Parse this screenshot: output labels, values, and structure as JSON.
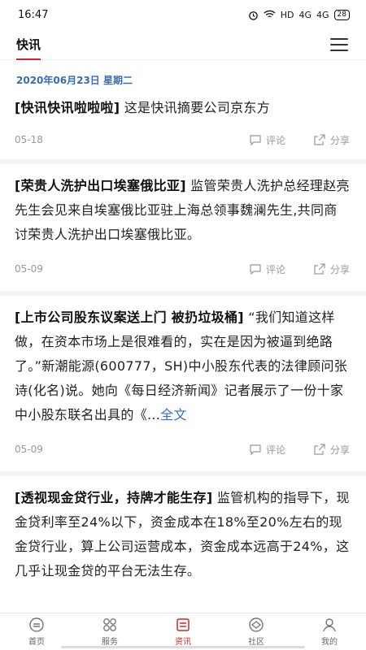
{
  "status_bar": {
    "time": "16:47",
    "network": "HD",
    "signal1": "4G",
    "signal2": "4G",
    "battery": "28"
  },
  "topbar": {
    "title": "快讯"
  },
  "date_line": "2020年06月23日  星期二",
  "feed": {
    "comment_label": "评论",
    "share_label": "分享",
    "items": [
      {
        "headline": "[快讯快讯啦啦啦]",
        "body": " 这是快讯摘要公司京东方",
        "more": "",
        "date": "05-18"
      },
      {
        "headline": "[荣贵人洗护出口埃塞俄比亚]",
        "body": " 监管荣贵人洗护总经理赵亮先生会见来自埃塞俄比亚驻上海总领事魏澜先生,共同商讨荣贵人洗护出口埃塞俄比亚。",
        "more": "",
        "date": "05-09"
      },
      {
        "headline": "[上市公司股东议案送上门 被扔垃圾桶]",
        "body": " “我们知道这样做，在资本市场上是很难看的，实在是因为被逼到绝路了。”新潮能源(600777，SH)中小股东代表的法律顾问张诗(化名)说。她向《每日经济新闻》记者展示了一份十家中小股东联名出具的《...",
        "more": "全文",
        "date": "05-09"
      },
      {
        "headline": "[透视现金贷行业，持牌才能生存]",
        "body": " 监管机构的指导下，现金贷利率至24%以下，资金成本在18%至20%左右的现金贷行业，算上公司运营成本，资金成本远高于24%，这几乎让现金贷的平台无法生存。",
        "more": "",
        "date": ""
      }
    ]
  },
  "bottom_nav": [
    {
      "label": "首页",
      "icon": "home-icon"
    },
    {
      "label": "服务",
      "icon": "grid-icon"
    },
    {
      "label": "资讯",
      "icon": "news-icon"
    },
    {
      "label": "社区",
      "icon": "community-icon"
    },
    {
      "label": "我的",
      "icon": "user-icon"
    }
  ],
  "colors": {
    "accent": "#d8232a",
    "date": "#3a6bb5",
    "link": "#2f6fc4"
  }
}
